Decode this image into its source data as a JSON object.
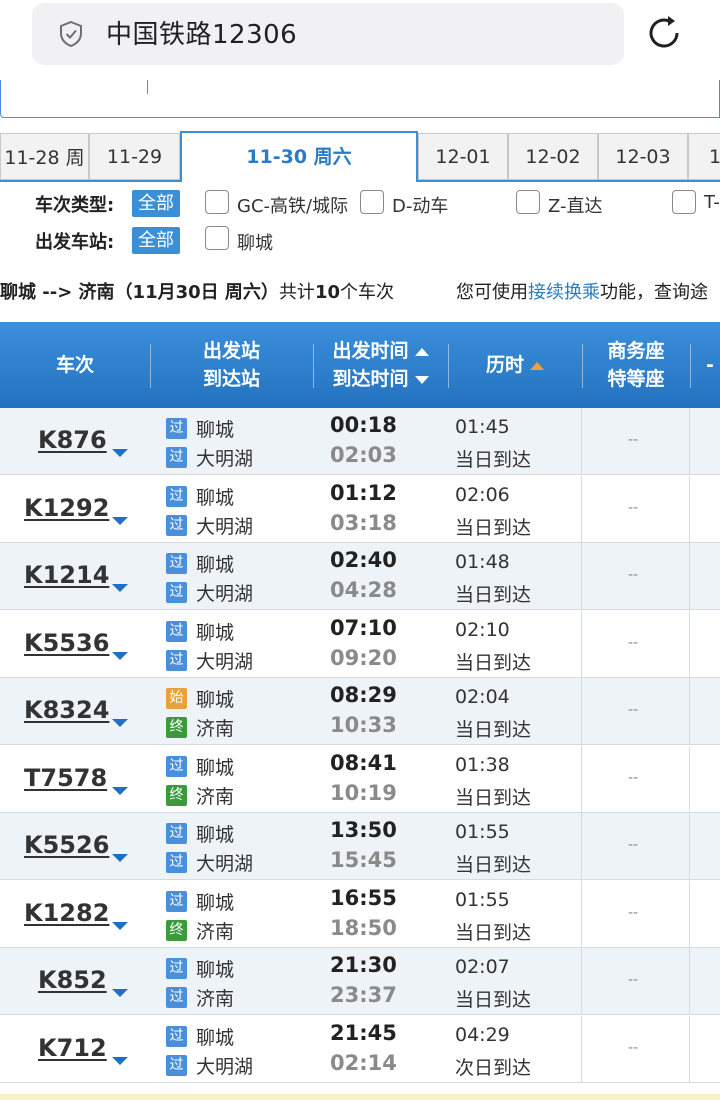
{
  "browser": {
    "url_text": "中国铁路12306",
    "icons": {
      "shield": "shield-icon",
      "reload": "reload-icon"
    }
  },
  "dates": [
    {
      "label": "11-28 周",
      "active": false
    },
    {
      "label": "11-29",
      "active": false
    },
    {
      "label": "11-30 周六",
      "active": true
    },
    {
      "label": "12-01",
      "active": false
    },
    {
      "label": "12-02",
      "active": false
    },
    {
      "label": "12-03",
      "active": false
    },
    {
      "label": "1",
      "active": false
    }
  ],
  "filters": {
    "type_label": "车次类型:",
    "all_label": "全部",
    "types": [
      "GC-高铁/城际",
      "D-动车",
      "Z-直达",
      "T-"
    ],
    "station_label": "出发车站:",
    "stations": [
      "聊城"
    ]
  },
  "summary": {
    "route": "聊城 --> 济南",
    "date": "（11月30日  周六）",
    "count_prefix": "共计",
    "count": "10",
    "count_suffix": "个车次",
    "hint_prefix": "您可使用",
    "hint_link": "接续换乘",
    "hint_suffix": "功能，查询途"
  },
  "table": {
    "headers": {
      "train": "车次",
      "station_1": "出发站",
      "station_2": "到达站",
      "time_1": "出发时间",
      "time_2": "到达时间",
      "duration": "历时",
      "seat_1": "商务座",
      "seat_2": "特等座",
      "more": "-"
    },
    "colors": {
      "pass": "#4a8fdb",
      "start": "#e8a23a",
      "end": "#3c9a3c"
    },
    "rows": [
      {
        "train": "K876",
        "from_badge": "过",
        "from_kind": "pass",
        "from": "聊城",
        "to_badge": "过",
        "to_kind": "pass",
        "to": "大明湖",
        "dep": "00:18",
        "arr": "02:03",
        "duration": "01:45",
        "arrive": "当日到达",
        "seat": "--"
      },
      {
        "train": "K1292",
        "from_badge": "过",
        "from_kind": "pass",
        "from": "聊城",
        "to_badge": "过",
        "to_kind": "pass",
        "to": "大明湖",
        "dep": "01:12",
        "arr": "03:18",
        "duration": "02:06",
        "arrive": "当日到达",
        "seat": "--"
      },
      {
        "train": "K1214",
        "from_badge": "过",
        "from_kind": "pass",
        "from": "聊城",
        "to_badge": "过",
        "to_kind": "pass",
        "to": "大明湖",
        "dep": "02:40",
        "arr": "04:28",
        "duration": "01:48",
        "arrive": "当日到达",
        "seat": "--"
      },
      {
        "train": "K5536",
        "from_badge": "过",
        "from_kind": "pass",
        "from": "聊城",
        "to_badge": "过",
        "to_kind": "pass",
        "to": "大明湖",
        "dep": "07:10",
        "arr": "09:20",
        "duration": "02:10",
        "arrive": "当日到达",
        "seat": "--"
      },
      {
        "train": "K8324",
        "from_badge": "始",
        "from_kind": "start",
        "from": "聊城",
        "to_badge": "终",
        "to_kind": "end",
        "to": "济南",
        "dep": "08:29",
        "arr": "10:33",
        "duration": "02:04",
        "arrive": "当日到达",
        "seat": "--"
      },
      {
        "train": "T7578",
        "from_badge": "过",
        "from_kind": "pass",
        "from": "聊城",
        "to_badge": "终",
        "to_kind": "end",
        "to": "济南",
        "dep": "08:41",
        "arr": "10:19",
        "duration": "01:38",
        "arrive": "当日到达",
        "seat": "--"
      },
      {
        "train": "K5526",
        "from_badge": "过",
        "from_kind": "pass",
        "from": "聊城",
        "to_badge": "过",
        "to_kind": "pass",
        "to": "大明湖",
        "dep": "13:50",
        "arr": "15:45",
        "duration": "01:55",
        "arrive": "当日到达",
        "seat": "--"
      },
      {
        "train": "K1282",
        "from_badge": "过",
        "from_kind": "pass",
        "from": "聊城",
        "to_badge": "终",
        "to_kind": "end",
        "to": "济南",
        "dep": "16:55",
        "arr": "18:50",
        "duration": "01:55",
        "arrive": "当日到达",
        "seat": "--"
      },
      {
        "train": "K852",
        "from_badge": "过",
        "from_kind": "pass",
        "from": "聊城",
        "to_badge": "过",
        "to_kind": "pass",
        "to": "济南",
        "dep": "21:30",
        "arr": "23:37",
        "duration": "02:07",
        "arrive": "当日到达",
        "seat": "--"
      },
      {
        "train": "K712",
        "from_badge": "过",
        "from_kind": "pass",
        "from": "聊城",
        "to_badge": "过",
        "to_kind": "pass",
        "to": "大明湖",
        "dep": "21:45",
        "arr": "02:14",
        "duration": "04:29",
        "arrive": "次日到达",
        "seat": "--"
      }
    ]
  }
}
